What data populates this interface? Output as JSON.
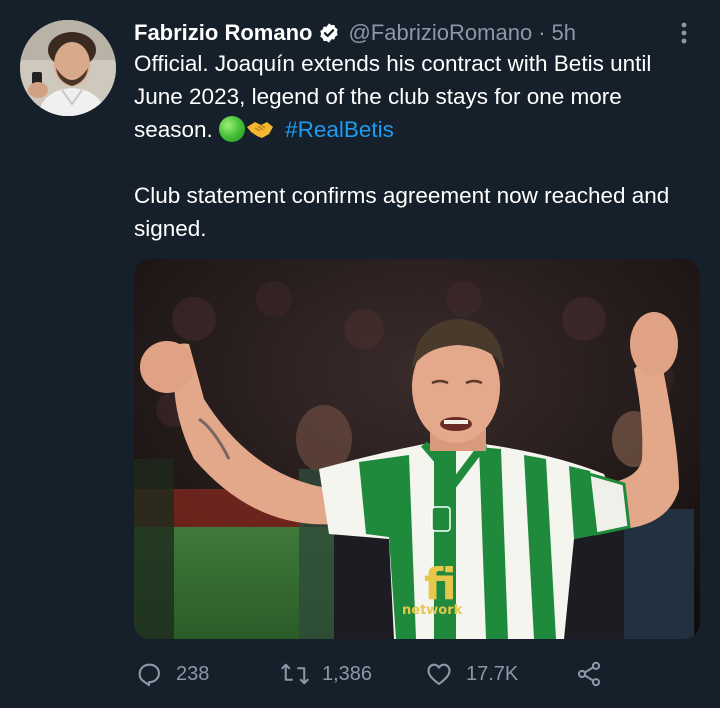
{
  "author": {
    "name": "Fabrizio Romano",
    "handle": "@FabrizioRomano",
    "separator": "·",
    "time": "5h",
    "verified": true
  },
  "tweet": {
    "line1": "Official. Joaquín extends his contract with Betis until June 2023, legend of the club stays for one more season.",
    "hashtag": "#RealBetis",
    "line2": "Club statement confirms agreement now reached and signed.",
    "emojis": [
      "green-circle-emoji",
      "handshake-emoji"
    ]
  },
  "media": {
    "shirt_sponsor": "fi",
    "shirt_sponsor_sub": "network"
  },
  "actions": {
    "replies": "238",
    "retweets": "1,386",
    "likes": "17.7K"
  },
  "colors": {
    "background": "#15202b",
    "text": "#ffffff",
    "muted": "#8b98a5",
    "link": "#1d9bf0",
    "betis_green": "#1f8a3c"
  },
  "icons": {
    "more": "more-vertical-icon",
    "reply": "reply-icon",
    "retweet": "retweet-icon",
    "like": "heart-icon",
    "share": "share-icon",
    "verified": "verified-badge-icon"
  }
}
